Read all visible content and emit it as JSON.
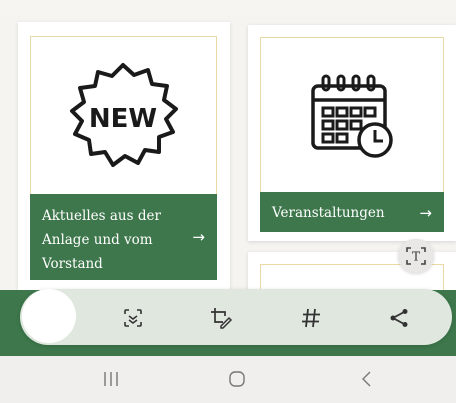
{
  "cards": [
    {
      "label": "Aktuelles aus der Anlage und vom Vorstand",
      "arrow": "→",
      "icon": "new-badge-icon",
      "badge_text": "NEW"
    },
    {
      "label": "Veranstaltungen",
      "arrow": "→",
      "icon": "calendar-clock-icon"
    }
  ],
  "toolbar": {
    "tools": [
      {
        "icon": "scan-icon"
      },
      {
        "icon": "crop-edit-icon"
      },
      {
        "icon": "hashtag-icon"
      },
      {
        "icon": "share-icon"
      }
    ]
  },
  "ocr_button": {
    "icon": "text-recognition-icon",
    "glyph": "T"
  },
  "nav": [
    "recent-apps-icon",
    "home-icon",
    "back-icon"
  ],
  "colors": {
    "green": "#3d774b",
    "gold_border": "#e9d9a6",
    "pill": "#dfe7df"
  }
}
